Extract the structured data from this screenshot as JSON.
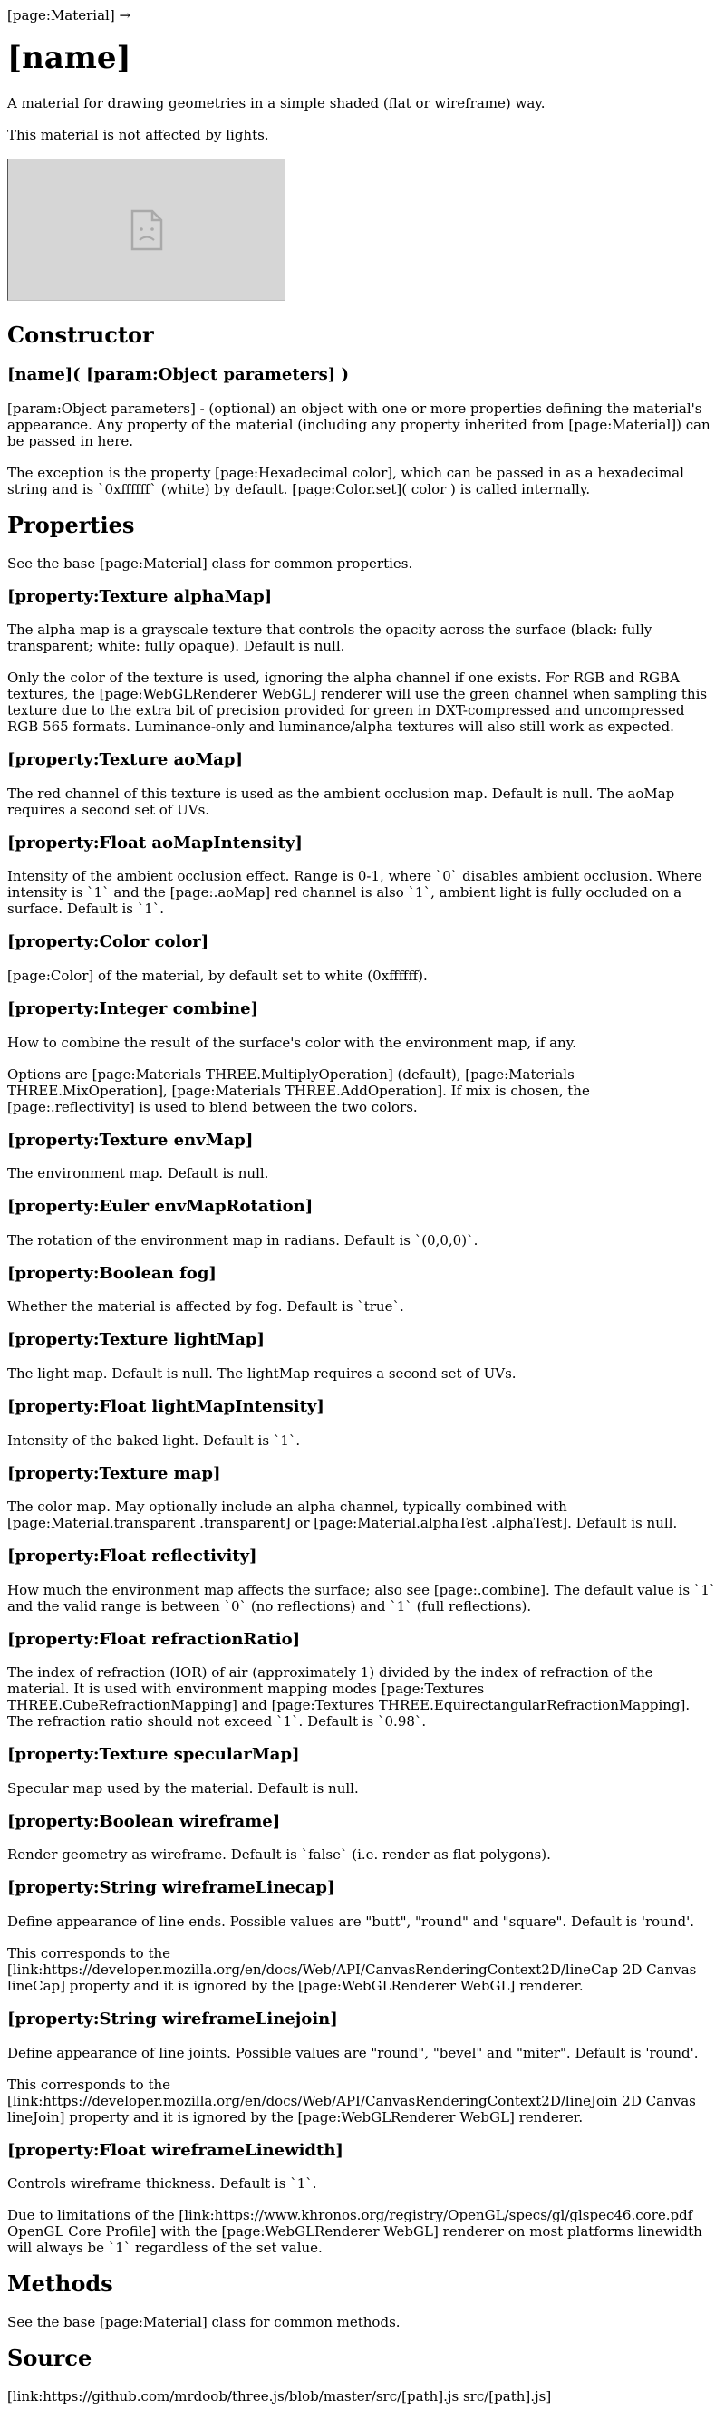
{
  "breadcrumb": "[page:Material] →",
  "title": "[name]",
  "intro": [
    "A material for drawing geometries in a simple shaded (flat or wireframe) way.",
    "This material is not affected by lights."
  ],
  "constructor": {
    "heading": "Constructor",
    "signature": "[name]( [param:Object parameters] )",
    "paragraphs": [
      "[param:Object parameters] - (optional) an object with one or more properties defining the material's appearance. Any property of the material (including any property inherited from [page:Material]) can be passed in here.",
      "The exception is the property [page:Hexadecimal color], which can be passed in as a hexadecimal string and is `0xffffff` (white) by default. [page:Color.set]( color ) is called internally."
    ]
  },
  "properties": {
    "heading": "Properties",
    "intro": "See the base [page:Material] class for common properties.",
    "items": [
      {
        "name": "[property:Texture alphaMap]",
        "paragraphs": [
          "The alpha map is a grayscale texture that controls the opacity across the surface (black: fully transparent; white: fully opaque). Default is null.",
          "Only the color of the texture is used, ignoring the alpha channel if one exists. For RGB and RGBA textures, the [page:WebGLRenderer WebGL] renderer will use the green channel when sampling this texture due to the extra bit of precision provided for green in DXT-compressed and uncompressed RGB 565 formats. Luminance-only and luminance/alpha textures will also still work as expected."
        ]
      },
      {
        "name": "[property:Texture aoMap]",
        "paragraphs": [
          "The red channel of this texture is used as the ambient occlusion map. Default is null. The aoMap requires a second set of UVs."
        ]
      },
      {
        "name": "[property:Float aoMapIntensity]",
        "paragraphs": [
          "Intensity of the ambient occlusion effect. Range is 0-1, where `0` disables ambient occlusion. Where intensity is `1` and the [page:.aoMap] red channel is also `1`, ambient light is fully occluded on a surface. Default is `1`."
        ]
      },
      {
        "name": "[property:Color color]",
        "paragraphs": [
          "[page:Color] of the material, by default set to white (0xffffff)."
        ]
      },
      {
        "name": "[property:Integer combine]",
        "paragraphs": [
          "How to combine the result of the surface's color with the environment map, if any.",
          "Options are [page:Materials THREE.MultiplyOperation] (default), [page:Materials THREE.MixOperation], [page:Materials THREE.AddOperation]. If mix is chosen, the [page:.reflectivity] is used to blend between the two colors."
        ]
      },
      {
        "name": "[property:Texture envMap]",
        "paragraphs": [
          "The environment map. Default is null."
        ]
      },
      {
        "name": "[property:Euler envMapRotation]",
        "paragraphs": [
          "The rotation of the environment map in radians. Default is `(0,0,0)`."
        ]
      },
      {
        "name": "[property:Boolean fog]",
        "paragraphs": [
          "Whether the material is affected by fog. Default is `true`."
        ]
      },
      {
        "name": "[property:Texture lightMap]",
        "paragraphs": [
          "The light map. Default is null. The lightMap requires a second set of UVs."
        ]
      },
      {
        "name": "[property:Float lightMapIntensity]",
        "paragraphs": [
          "Intensity of the baked light. Default is `1`."
        ]
      },
      {
        "name": "[property:Texture map]",
        "paragraphs": [
          "The color map. May optionally include an alpha channel, typically combined with [page:Material.transparent .transparent] or [page:Material.alphaTest .alphaTest]. Default is null."
        ]
      },
      {
        "name": "[property:Float reflectivity]",
        "paragraphs": [
          "How much the environment map affects the surface; also see [page:.combine]. The default value is `1` and the valid range is between `0` (no reflections) and `1` (full reflections)."
        ]
      },
      {
        "name": "[property:Float refractionRatio]",
        "paragraphs": [
          "The index of refraction (IOR) of air (approximately 1) divided by the index of refraction of the material. It is used with environment mapping modes [page:Textures THREE.CubeRefractionMapping] and [page:Textures THREE.EquirectangularRefractionMapping]. The refraction ratio should not exceed `1`. Default is `0.98`."
        ]
      },
      {
        "name": "[property:Texture specularMap]",
        "paragraphs": [
          "Specular map used by the material. Default is null."
        ]
      },
      {
        "name": "[property:Boolean wireframe]",
        "paragraphs": [
          "Render geometry as wireframe. Default is `false` (i.e. render as flat polygons)."
        ]
      },
      {
        "name": "[property:String wireframeLinecap]",
        "paragraphs": [
          "Define appearance of line ends. Possible values are \"butt\", \"round\" and \"square\". Default is 'round'.",
          "This corresponds to the [link:https://developer.mozilla.org/en/docs/Web/API/CanvasRenderingContext2D/lineCap 2D Canvas lineCap] property and it is ignored by the [page:WebGLRenderer WebGL] renderer."
        ]
      },
      {
        "name": "[property:String wireframeLinejoin]",
        "paragraphs": [
          "Define appearance of line joints. Possible values are \"round\", \"bevel\" and \"miter\". Default is 'round'.",
          "This corresponds to the [link:https://developer.mozilla.org/en/docs/Web/API/CanvasRenderingContext2D/lineJoin 2D Canvas lineJoin] property and it is ignored by the [page:WebGLRenderer WebGL] renderer."
        ]
      },
      {
        "name": "[property:Float wireframeLinewidth]",
        "paragraphs": [
          "Controls wireframe thickness. Default is `1`.",
          "Due to limitations of the [link:https://www.khronos.org/registry/OpenGL/specs/gl/glspec46.core.pdf OpenGL Core Profile] with the [page:WebGLRenderer WebGL] renderer on most platforms linewidth will always be `1` regardless of the set value."
        ]
      }
    ]
  },
  "methods": {
    "heading": "Methods",
    "intro": "See the base [page:Material] class for common methods."
  },
  "source": {
    "heading": "Source",
    "text": "[link:https://github.com/mrdoob/three.js/blob/master/src/[path].js src/[path].js]"
  },
  "image_placeholder_icon": "broken-image-icon"
}
